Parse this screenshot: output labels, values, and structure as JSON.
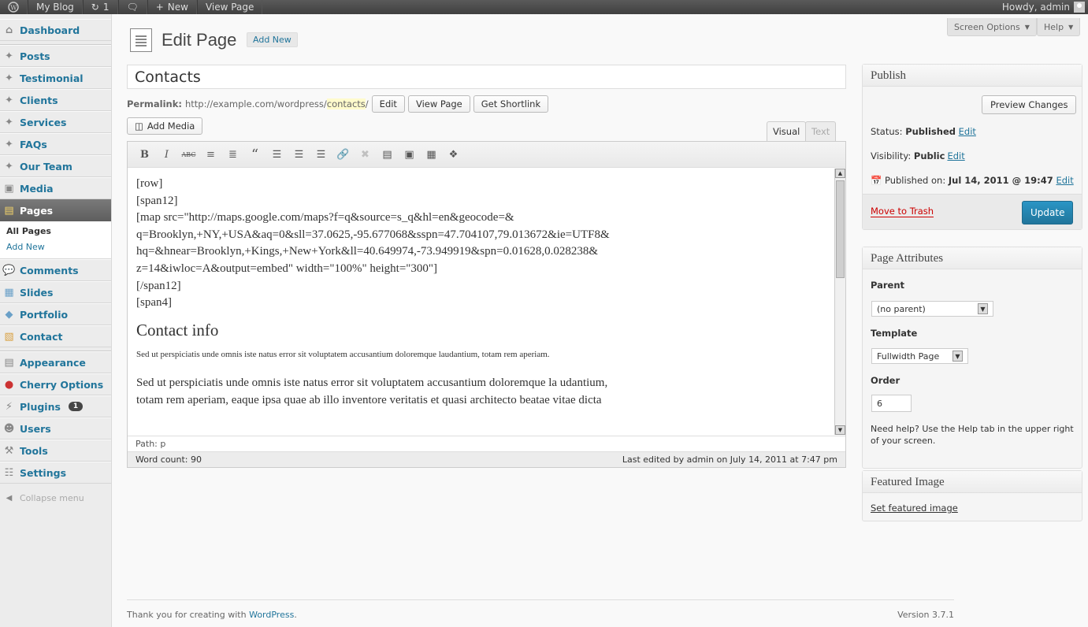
{
  "adminbar": {
    "site": "My Blog",
    "updates": "1",
    "new": "New",
    "view": "View Page",
    "greeting": "Howdy, admin"
  },
  "menu": {
    "dashboard": "Dashboard",
    "posts": "Posts",
    "testimonial": "Testimonial",
    "clients": "Clients",
    "services": "Services",
    "faqs": "FAQs",
    "team": "Our Team",
    "media": "Media",
    "pages": "Pages",
    "all_pages": "All Pages",
    "add_new": "Add New",
    "comments": "Comments",
    "slides": "Slides",
    "portfolio": "Portfolio",
    "contact": "Contact",
    "appearance": "Appearance",
    "cherry": "Cherry Options",
    "plugins": "Plugins",
    "plugins_count": "1",
    "users": "Users",
    "tools": "Tools",
    "settings": "Settings",
    "collapse": "Collapse menu"
  },
  "header": {
    "title": "Edit Page",
    "add_new": "Add New",
    "screen_options": "Screen Options",
    "help": "Help"
  },
  "post": {
    "title": "Contacts",
    "permalink_label": "Permalink:",
    "permalink_base": "http://example.com/wordpress/",
    "slug": "contacts",
    "slash": "/",
    "edit": "Edit",
    "view": "View Page",
    "shortlink": "Get Shortlink"
  },
  "editor": {
    "add_media": "Add Media",
    "tab_visual": "Visual",
    "tab_text": "Text",
    "lines": [
      "[row]",
      "[span12]",
      "[map src=\"http://maps.google.com/maps?f=q&source=s_q&hl=en&geocode=&",
      "q=Brooklyn,+NY,+USA&aq=0&sll=37.0625,-95.677068&sspn=47.704107,79.013672&ie=UTF8&",
      "hq=&hnear=Brooklyn,+Kings,+New+York&ll=40.649974,-73.949919&spn=0.01628,0.028238&",
      "z=14&iwloc=A&output=embed\" width=\"100%\" height=\"300\"]",
      "[/span12]",
      "[span4]"
    ],
    "heading": "Contact info",
    "small": "Sed ut perspiciatis unde omnis iste natus error sit voluptatem accusantium doloremque laudantium, totam rem aperiam.",
    "para1": "Sed ut perspiciatis unde omnis iste natus error sit voluptatem accusantium doloremque la udantium,",
    "para2": "totam rem aperiam, eaque ipsa quae ab illo inventore veritatis et quasi architecto beatae vitae dicta",
    "path": "Path: p",
    "word_count": "Word count: 90",
    "last_edited": "Last edited by admin on July 14, 2011 at 7:47 pm"
  },
  "publish": {
    "title": "Publish",
    "preview": "Preview Changes",
    "status_label": "Status:",
    "status": "Published",
    "edit": "Edit",
    "visibility_label": "Visibility:",
    "visibility": "Public",
    "published_label": "Published on:",
    "published": "Jul 14, 2011 @ 19:47",
    "trash": "Move to Trash",
    "update": "Update"
  },
  "attributes": {
    "title": "Page Attributes",
    "parent_label": "Parent",
    "parent": "(no parent)",
    "template_label": "Template",
    "template": "Fullwidth Page",
    "order_label": "Order",
    "order": "6",
    "help": "Need help? Use the Help tab in the upper right of your screen."
  },
  "featured": {
    "title": "Featured Image",
    "link": "Set featured image"
  },
  "footer": {
    "thanks": "Thank you for creating with ",
    "wp": "WordPress",
    "dot": ".",
    "version": "Version 3.7.1"
  }
}
